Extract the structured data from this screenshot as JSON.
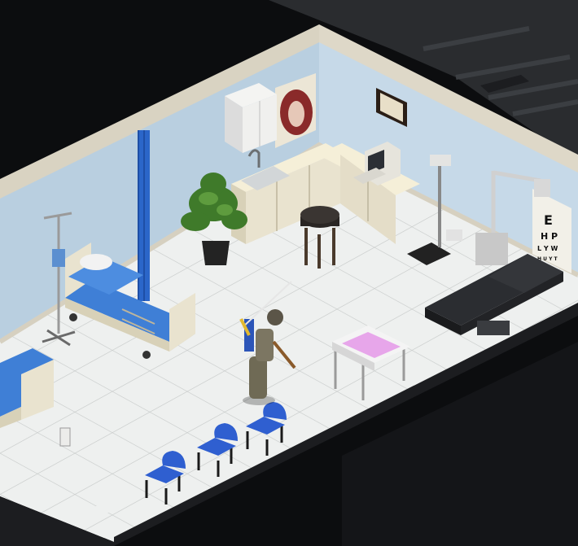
{
  "scene": {
    "room": "medical-exam-room",
    "view": "isometric",
    "eye_chart": {
      "line1": "E",
      "line2": "H P",
      "line3": "L Y W",
      "line4": "H U Y T"
    },
    "colors": {
      "wall_blue": "#b9cfe0",
      "floor_tile": "#eef0ef",
      "cabinet": "#e9e3cf",
      "curtain": "#2b66c9",
      "chair_blue": "#2f5fd0",
      "bed_blue": "#3f7fd6",
      "exam_table": "#2b2d31",
      "background": "#0c0d0f"
    }
  }
}
